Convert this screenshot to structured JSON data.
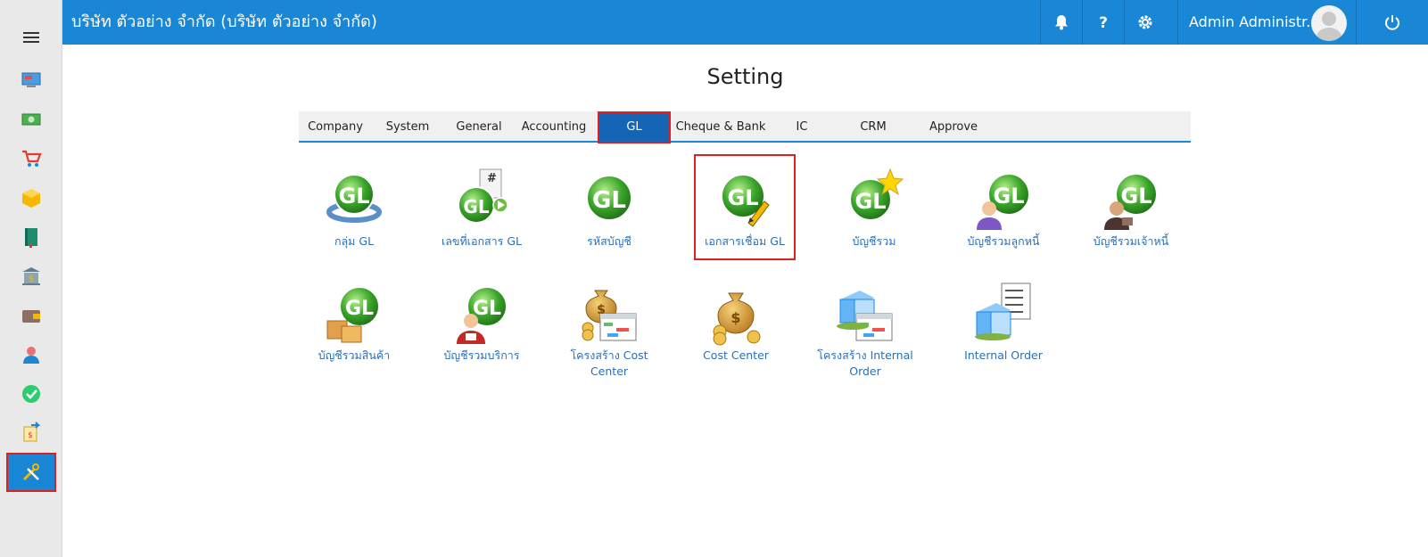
{
  "header": {
    "company": "บริษัท ตัวอย่าง จำกัด (บริษัท ตัวอย่าง จำกัด)",
    "user": "Admin Administr...",
    "icons": [
      "bell-icon",
      "help-icon",
      "gear-icon",
      "power-icon"
    ]
  },
  "sidebar": {
    "items": [
      {
        "icon": "menu-icon"
      },
      {
        "icon": "dashboard-icon"
      },
      {
        "icon": "money-icon"
      },
      {
        "icon": "cart-icon"
      },
      {
        "icon": "box-icon"
      },
      {
        "icon": "book-icon"
      },
      {
        "icon": "bank-icon"
      },
      {
        "icon": "wallet-icon"
      },
      {
        "icon": "users-icon"
      },
      {
        "icon": "approve-icon"
      },
      {
        "icon": "transfer-icon"
      },
      {
        "icon": "tools-icon",
        "active": true
      }
    ]
  },
  "page": {
    "title": "Setting"
  },
  "tabs": [
    {
      "label": "Company"
    },
    {
      "label": "System"
    },
    {
      "label": "General"
    },
    {
      "label": "Accounting"
    },
    {
      "label": "GL",
      "active": true
    },
    {
      "label": "Cheque & Bank"
    },
    {
      "label": "IC"
    },
    {
      "label": "CRM"
    },
    {
      "label": "Approve"
    }
  ],
  "tiles": [
    {
      "label": "กลุ่ม GL",
      "icon": "gl-group-icon"
    },
    {
      "label": "เลขที่เอกสาร GL",
      "icon": "gl-doc-number-icon"
    },
    {
      "label": "รหัสบัญชี",
      "icon": "gl-account-code-icon"
    },
    {
      "label": "เอกสารเชื่อม GL",
      "icon": "gl-link-doc-icon",
      "selected": true
    },
    {
      "label": "บัญชีรวม",
      "icon": "gl-consolidated-icon"
    },
    {
      "label": "บัญชีรวมลูกหนี้",
      "icon": "gl-debtor-icon"
    },
    {
      "label": "บัญชีรวมเจ้าหนี้",
      "icon": "gl-creditor-icon"
    },
    {
      "label": "บัญชีรวมสินค้า",
      "icon": "gl-product-icon"
    },
    {
      "label": "บัญชีรวมบริการ",
      "icon": "gl-service-icon"
    },
    {
      "label": "โครงสร้าง Cost Center",
      "icon": "cost-center-structure-icon"
    },
    {
      "label": "Cost Center",
      "icon": "cost-center-icon"
    },
    {
      "label": "โครงสร้าง Internal Order",
      "icon": "internal-order-structure-icon"
    },
    {
      "label": "Internal Order",
      "icon": "internal-order-icon"
    }
  ],
  "colors": {
    "primary": "#1a86d6",
    "highlight": "#e02020",
    "gl_green": "#3aa52a"
  }
}
